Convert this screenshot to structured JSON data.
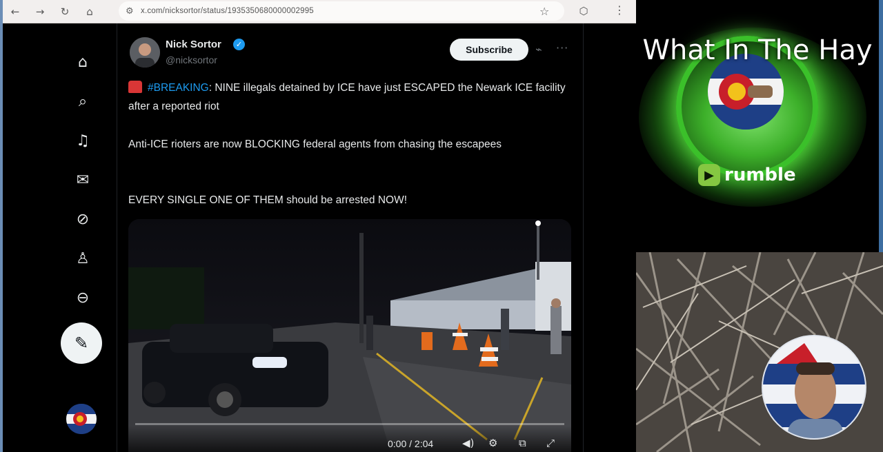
{
  "browser": {
    "url": "x.com/nicksortor/status/1935350680000002995",
    "back_icon": "←",
    "forward_icon": "→",
    "reload_icon": "↻",
    "home_icon": "⌂",
    "tune_icon": "⚙",
    "star_icon": "☆",
    "extensions_icon": "⬡",
    "menu_icon": "⋮"
  },
  "sidebar": {
    "items": [
      {
        "name": "home",
        "glyph": "⌂"
      },
      {
        "name": "explore",
        "glyph": "⌕"
      },
      {
        "name": "notifications",
        "glyph": "♫"
      },
      {
        "name": "messages",
        "glyph": "✉"
      },
      {
        "name": "grok",
        "glyph": "⊘"
      },
      {
        "name": "profile",
        "glyph": "♙"
      },
      {
        "name": "more",
        "glyph": "⊖"
      }
    ],
    "post_glyph": "✎"
  },
  "tweet": {
    "author_name": "Nick Sortor",
    "verified_glyph": "✓",
    "handle": "@nicksortor",
    "subscribe_label": "Subscribe",
    "grok_glyph": "⌁",
    "more_glyph": "···",
    "hashtag": "#BREAKING",
    "line1_rest": ": NINE illegals detained by ICE have just ESCAPED the Newark ICE facility after a reported riot",
    "line2": "Anti-ICE rioters are now BLOCKING federal agents from chasing the escapees",
    "line3": "EVERY SINGLE ONE OF THEM should be arrested NOW!",
    "video": {
      "time": "0:00 / 2:04",
      "progress": 0.0,
      "volume_glyph": "◀)",
      "settings_glyph": "⚙",
      "pip_glyph": "⧉",
      "fullscreen_glyph": "⤢"
    }
  },
  "rumble": {
    "channel_title": "What In The Hay",
    "brand": "rumble",
    "play_glyph": "▶",
    "accent": "#85c742"
  }
}
